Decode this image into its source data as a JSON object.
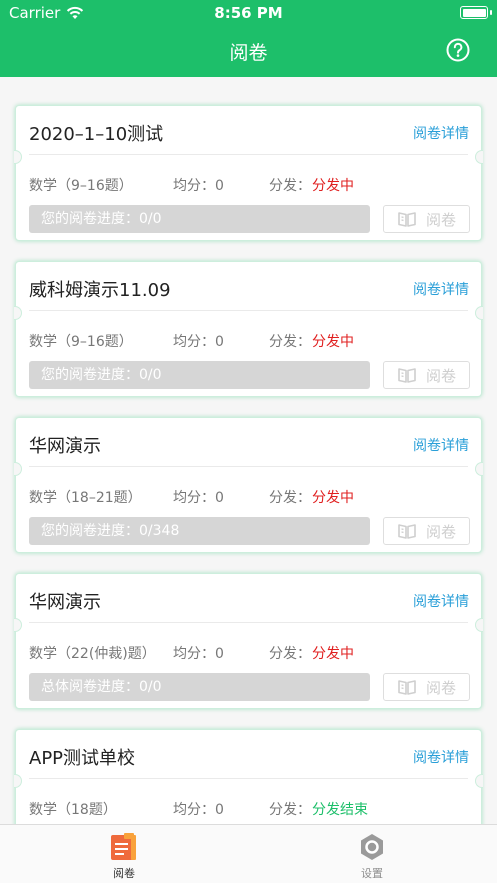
{
  "status_bar": {
    "carrier": "Carrier",
    "time": "8:56 PM"
  },
  "nav": {
    "title": "阅卷",
    "help_icon": "question-circle-icon"
  },
  "colors": {
    "primary": "#1dbf6a",
    "link": "#2a9fd8",
    "in_progress": "#e02020",
    "finished": "#1dbf6a"
  },
  "exams": [
    {
      "title": "2020–1–10测试",
      "detail_link": "阅卷详情",
      "subject": "数学（9–16题）",
      "avg": "均分：0",
      "dist_label": "分发：",
      "dist_status": "分发中",
      "status_color": "red",
      "progress": "您的阅卷进度：0/0",
      "button": "阅卷"
    },
    {
      "title": "威科姆演示11.09",
      "detail_link": "阅卷详情",
      "subject": "数学（9–16题）",
      "avg": "均分：0",
      "dist_label": "分发：",
      "dist_status": "分发中",
      "status_color": "red",
      "progress": "您的阅卷进度：0/0",
      "button": "阅卷"
    },
    {
      "title": "华网演示",
      "detail_link": "阅卷详情",
      "subject": "数学（18–21题）",
      "avg": "均分：0",
      "dist_label": "分发：",
      "dist_status": "分发中",
      "status_color": "red",
      "progress": "您的阅卷进度：0/348",
      "button": "阅卷"
    },
    {
      "title": "华网演示",
      "detail_link": "阅卷详情",
      "subject": "数学（22(仲裁)题）",
      "avg": "均分：0",
      "dist_label": "分发：",
      "dist_status": "分发中",
      "status_color": "red",
      "progress": "总体阅卷进度：0/0",
      "button": "阅卷"
    },
    {
      "title": "APP测试单校",
      "detail_link": "阅卷详情",
      "subject": "数学（18题）",
      "avg": "均分：0",
      "dist_label": "分发：",
      "dist_status": "分发结束",
      "status_color": "green",
      "progress": "",
      "button": ""
    }
  ],
  "tabbar": {
    "tabs": [
      {
        "label": "阅卷",
        "icon": "document-icon",
        "active": true
      },
      {
        "label": "设置",
        "icon": "gear-hexagon-icon",
        "active": false
      }
    ]
  }
}
